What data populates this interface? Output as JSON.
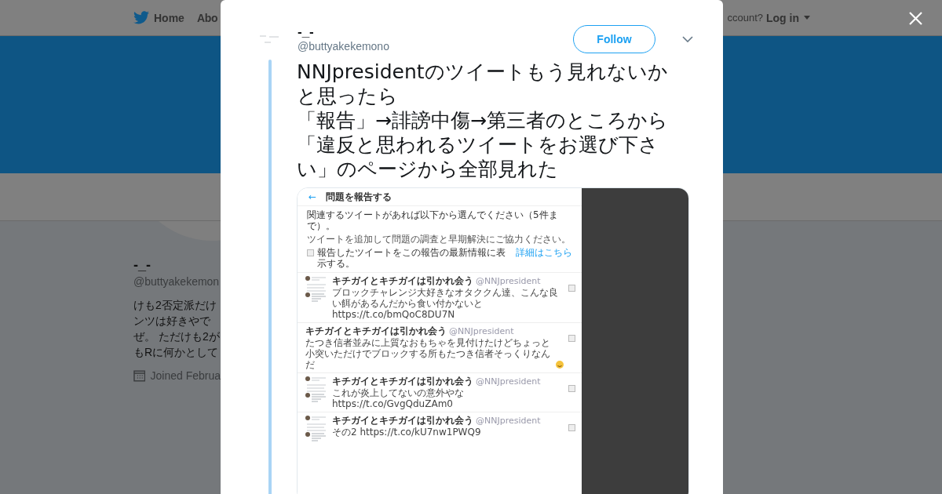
{
  "nav": {
    "home": "Home",
    "about": "Abo",
    "account_prompt": "ccount?",
    "login": "Log in"
  },
  "profile": {
    "name": "-_-",
    "handle": "@buttyakekemon",
    "bio_lines": [
      "けも2否定派だけ",
      "ンツは好きやで",
      "ぜ。 ただけも2が",
      "もRに何かとして"
    ],
    "joined": "Joined Februa"
  },
  "modal": {
    "author": {
      "name": "-_-",
      "handle": "@buttyakekemono"
    },
    "follow_button": "Follow",
    "tweet_lines": [
      "NNJpresidentのツイートもう見れないかと思ったら",
      "「報告」→誹謗中傷→第三者のところから",
      "「違反と思われるツイートをお選び下さい」のページから全部見れた"
    ],
    "screenshot": {
      "back": "←",
      "title": "問題を報告する",
      "heading": "関連するツイートがあれば以下から選んでください（5件まで）。",
      "note": "ツイートを追加して問題の調査と早期解決にご協力ください。",
      "option": {
        "label": "報告したツイートをこの報告の最新情報に表示する。",
        "link": "詳細はこちら",
        "checked": false
      },
      "rows": [
        {
          "name": "キチガイとキチガイは引かれ会う",
          "handle": "@NNJpresident",
          "text": "ブロックチャレンジ大好きなオタククん達、こんな良い餌があるんだから食い付かないと https://t.co/bmQoC8DU7N",
          "thumbnail": true,
          "emoji": false,
          "checked": false
        },
        {
          "name": "キチガイとキチガイは引かれ会う",
          "handle": "@NNJpresident",
          "text": "たつき信者並みに上質なおもちゃを見付けたけどちょっと小突いただけでブロックする所もたつき信者そっくりなんだ",
          "thumbnail": false,
          "emoji": true,
          "checked": false
        },
        {
          "name": "キチガイとキチガイは引かれ会う",
          "handle": "@NNJpresident",
          "text": "これが炎上してないの意外やな https://t.co/GvgQduZAm0",
          "thumbnail": true,
          "emoji": false,
          "checked": false
        },
        {
          "name": "キチガイとキチガイは引かれ会う",
          "handle": "@NNJpresident",
          "text": "その2 https://t.co/kU7nw1PWQ9",
          "thumbnail": true,
          "emoji": false,
          "checked": false
        }
      ]
    }
  }
}
